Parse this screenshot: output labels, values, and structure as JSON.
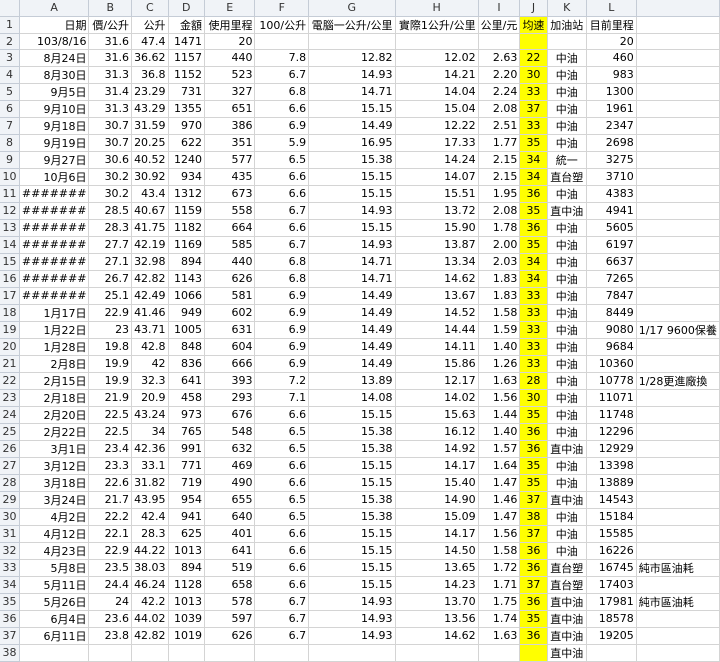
{
  "columns": [
    "A",
    "B",
    "C",
    "D",
    "E",
    "F",
    "G",
    "H",
    "I",
    "J",
    "K",
    "L",
    ""
  ],
  "headers": [
    "日期",
    "價/公升",
    "公升",
    "金額",
    "使用里程",
    "100/公升",
    "電腦一公升/公里",
    "實際1公升/公里",
    "公里/元",
    "均速",
    "加油站",
    "目前里程",
    ""
  ],
  "rows": [
    [
      "103/8/16",
      "31.6",
      "47.4",
      "1471",
      "20",
      "",
      "",
      "",
      "",
      "",
      "",
      "20",
      ""
    ],
    [
      "8月24日",
      "31.6",
      "36.62",
      "1157",
      "440",
      "7.8",
      "12.82",
      "12.02",
      "2.63",
      "22",
      "中油",
      "460",
      ""
    ],
    [
      "8月30日",
      "31.3",
      "36.8",
      "1152",
      "523",
      "6.7",
      "14.93",
      "14.21",
      "2.20",
      "30",
      "中油",
      "983",
      ""
    ],
    [
      "9月5日",
      "31.4",
      "23.29",
      "731",
      "327",
      "6.8",
      "14.71",
      "14.04",
      "2.24",
      "33",
      "中油",
      "1300",
      ""
    ],
    [
      "9月10日",
      "31.3",
      "43.29",
      "1355",
      "651",
      "6.6",
      "15.15",
      "15.04",
      "2.08",
      "37",
      "中油",
      "1961",
      ""
    ],
    [
      "9月18日",
      "30.7",
      "31.59",
      "970",
      "386",
      "6.9",
      "14.49",
      "12.22",
      "2.51",
      "33",
      "中油",
      "2347",
      ""
    ],
    [
      "9月19日",
      "30.7",
      "20.25",
      "622",
      "351",
      "5.9",
      "16.95",
      "17.33",
      "1.77",
      "35",
      "中油",
      "2698",
      ""
    ],
    [
      "9月27日",
      "30.6",
      "40.52",
      "1240",
      "577",
      "6.5",
      "15.38",
      "14.24",
      "2.15",
      "34",
      "統一",
      "3275",
      ""
    ],
    [
      "10月6日",
      "30.2",
      "30.92",
      "934",
      "435",
      "6.6",
      "15.15",
      "14.07",
      "2.15",
      "34",
      "直台塑",
      "3710",
      ""
    ],
    [
      "#######",
      "30.2",
      "43.4",
      "1312",
      "673",
      "6.6",
      "15.15",
      "15.51",
      "1.95",
      "36",
      "中油",
      "4383",
      ""
    ],
    [
      "#######",
      "28.5",
      "40.67",
      "1159",
      "558",
      "6.7",
      "14.93",
      "13.72",
      "2.08",
      "35",
      "直中油",
      "4941",
      ""
    ],
    [
      "#######",
      "28.3",
      "41.75",
      "1182",
      "664",
      "6.6",
      "15.15",
      "15.90",
      "1.78",
      "36",
      "中油",
      "5605",
      ""
    ],
    [
      "#######",
      "27.7",
      "42.19",
      "1169",
      "585",
      "6.7",
      "14.93",
      "13.87",
      "2.00",
      "35",
      "中油",
      "6197",
      ""
    ],
    [
      "#######",
      "27.1",
      "32.98",
      "894",
      "440",
      "6.8",
      "14.71",
      "13.34",
      "2.03",
      "34",
      "中油",
      "6637",
      ""
    ],
    [
      "#######",
      "26.7",
      "42.82",
      "1143",
      "626",
      "6.8",
      "14.71",
      "14.62",
      "1.83",
      "34",
      "中油",
      "7265",
      ""
    ],
    [
      "#######",
      "25.1",
      "42.49",
      "1066",
      "581",
      "6.9",
      "14.49",
      "13.67",
      "1.83",
      "33",
      "中油",
      "7847",
      ""
    ],
    [
      "1月17日",
      "22.9",
      "41.46",
      "949",
      "602",
      "6.9",
      "14.49",
      "14.52",
      "1.58",
      "33",
      "中油",
      "8449",
      ""
    ],
    [
      "1月22日",
      "23",
      "43.71",
      "1005",
      "631",
      "6.9",
      "14.49",
      "14.44",
      "1.59",
      "33",
      "中油",
      "9080",
      "1/17 9600保養"
    ],
    [
      "1月28日",
      "19.8",
      "42.8",
      "848",
      "604",
      "6.9",
      "14.49",
      "14.11",
      "1.40",
      "33",
      "中油",
      "9684",
      ""
    ],
    [
      "2月8日",
      "19.9",
      "42",
      "836",
      "666",
      "6.9",
      "14.49",
      "15.86",
      "1.26",
      "33",
      "中油",
      "10360",
      ""
    ],
    [
      "2月15日",
      "19.9",
      "32.3",
      "641",
      "393",
      "7.2",
      "13.89",
      "12.17",
      "1.63",
      "28",
      "中油",
      "10778",
      "1/28更進廠換"
    ],
    [
      "2月18日",
      "21.9",
      "20.9",
      "458",
      "293",
      "7.1",
      "14.08",
      "14.02",
      "1.56",
      "30",
      "中油",
      "11071",
      ""
    ],
    [
      "2月20日",
      "22.5",
      "43.24",
      "973",
      "676",
      "6.6",
      "15.15",
      "15.63",
      "1.44",
      "35",
      "中油",
      "11748",
      ""
    ],
    [
      "2月22日",
      "22.5",
      "34",
      "765",
      "548",
      "6.5",
      "15.38",
      "16.12",
      "1.40",
      "36",
      "中油",
      "12296",
      ""
    ],
    [
      "3月1日",
      "23.4",
      "42.36",
      "991",
      "632",
      "6.5",
      "15.38",
      "14.92",
      "1.57",
      "36",
      "直中油",
      "12929",
      ""
    ],
    [
      "3月12日",
      "23.3",
      "33.1",
      "771",
      "469",
      "6.6",
      "15.15",
      "14.17",
      "1.64",
      "35",
      "中油",
      "13398",
      ""
    ],
    [
      "3月18日",
      "22.6",
      "31.82",
      "719",
      "490",
      "6.6",
      "15.15",
      "15.40",
      "1.47",
      "35",
      "中油",
      "13889",
      ""
    ],
    [
      "3月24日",
      "21.7",
      "43.95",
      "954",
      "655",
      "6.5",
      "15.38",
      "14.90",
      "1.46",
      "37",
      "直中油",
      "14543",
      ""
    ],
    [
      "4月2日",
      "22.2",
      "42.4",
      "941",
      "640",
      "6.5",
      "15.38",
      "15.09",
      "1.47",
      "38",
      "中油",
      "15184",
      ""
    ],
    [
      "4月12日",
      "22.1",
      "28.3",
      "625",
      "401",
      "6.6",
      "15.15",
      "14.17",
      "1.56",
      "37",
      "中油",
      "15585",
      ""
    ],
    [
      "4月23日",
      "22.9",
      "44.22",
      "1013",
      "641",
      "6.6",
      "15.15",
      "14.50",
      "1.58",
      "36",
      "中油",
      "16226",
      ""
    ],
    [
      "5月8日",
      "23.5",
      "38.03",
      "894",
      "519",
      "6.6",
      "15.15",
      "13.65",
      "1.72",
      "36",
      "直台塑",
      "16745",
      "純市區油耗"
    ],
    [
      "5月11日",
      "24.4",
      "46.24",
      "1128",
      "658",
      "6.6",
      "15.15",
      "14.23",
      "1.71",
      "37",
      "直台塑",
      "17403",
      ""
    ],
    [
      "5月26日",
      "24",
      "42.2",
      "1013",
      "578",
      "6.7",
      "14.93",
      "13.70",
      "1.75",
      "36",
      "直中油",
      "17981",
      "純市區油耗"
    ],
    [
      "6月4日",
      "23.6",
      "44.02",
      "1039",
      "597",
      "6.7",
      "14.93",
      "13.56",
      "1.74",
      "35",
      "直中油",
      "18578",
      ""
    ],
    [
      "6月11日",
      "23.8",
      "42.82",
      "1019",
      "626",
      "6.7",
      "14.93",
      "14.62",
      "1.63",
      "36",
      "直中油",
      "19205",
      ""
    ],
    [
      "",
      "",
      "",
      "",
      "",
      "",
      "",
      "",
      "",
      "",
      "直中油",
      "",
      ""
    ]
  ]
}
